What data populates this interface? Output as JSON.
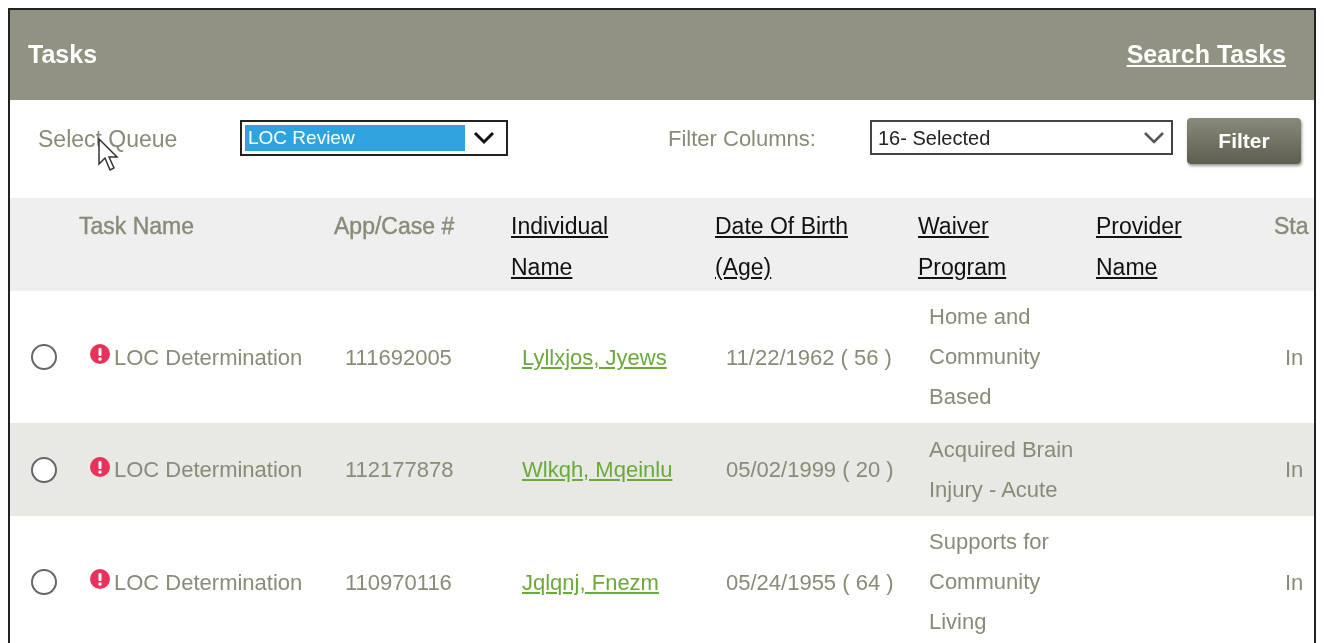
{
  "panel": {
    "title": "Tasks",
    "link": "Search Tasks"
  },
  "toolbar": {
    "queue_label": "Select Queue",
    "queue_value": "LOC Review",
    "queue_focused": true,
    "filter_label": "Filter Columns:",
    "filter_value": "16- Selected",
    "filter_button": "Filter"
  },
  "table": {
    "columns": [
      {
        "label": "Task Name",
        "sortable": false
      },
      {
        "label": "App/Case #",
        "sortable": false
      },
      {
        "label": "Individual Name",
        "sortable": true
      },
      {
        "label": "Date Of Birth (Age)",
        "sortable": true
      },
      {
        "label": "Waiver Program",
        "sortable": true
      },
      {
        "label": "Provider Name",
        "sortable": true
      },
      {
        "label": "Sta",
        "sortable": false
      }
    ],
    "rows": [
      {
        "selected": false,
        "alert": true,
        "task": "LOC Determination",
        "case": "111692005",
        "name": "Lyllxjos, Jyews",
        "dob": "11/22/1962 ( 56 )",
        "waiver": "Home and Community Based",
        "status": "In"
      },
      {
        "selected": false,
        "alert": true,
        "task": "LOC Determination",
        "case": "112177878",
        "name": "Wlkqh, Mqeinlu",
        "dob": "05/02/1999 ( 20 )",
        "waiver": "Acquired Brain Injury - Acute",
        "status": "In"
      },
      {
        "selected": false,
        "alert": true,
        "task": "LOC Determination",
        "case": "110970116",
        "name": "Jqlqnj, Fnezm",
        "dob": "05/24/1955 ( 64 )",
        "waiver": "Supports for Community Living",
        "status": "In"
      }
    ]
  }
}
